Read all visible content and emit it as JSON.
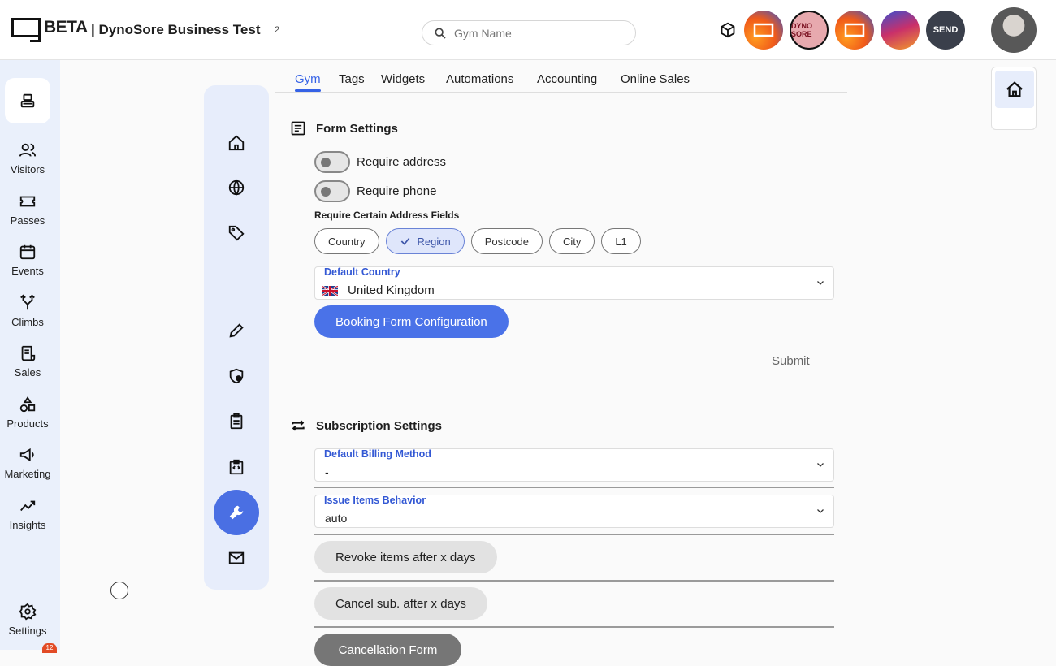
{
  "header": {
    "logo_text": "BETA",
    "business_name": "| DynoSore Business Test",
    "business_count": "2",
    "search_placeholder": "Gym Name",
    "gyms": [
      {
        "name": "gym-1",
        "color": "#f26b1d"
      },
      {
        "name": "gym-2",
        "text": "DYNO SORE",
        "color": "#d66e7b"
      },
      {
        "name": "gym-3",
        "color": "#f26b1d"
      },
      {
        "name": "gym-4",
        "color": "#c33a6e"
      },
      {
        "name": "gym-5",
        "text": "SEND",
        "color": "#3a3f4b"
      }
    ]
  },
  "sidebar": {
    "items": [
      {
        "label": "Visitors",
        "icon": "users-icon"
      },
      {
        "label": "Passes",
        "icon": "ticket-icon"
      },
      {
        "label": "Events",
        "icon": "calendar-icon"
      },
      {
        "label": "Climbs",
        "icon": "route-icon"
      },
      {
        "label": "Sales",
        "icon": "receipt-icon"
      },
      {
        "label": "Products",
        "icon": "shapes-icon"
      },
      {
        "label": "Marketing",
        "icon": "megaphone-icon"
      },
      {
        "label": "Insights",
        "icon": "chart-icon"
      }
    ],
    "settings_label": "Settings",
    "settings_badge": "12"
  },
  "tabs": [
    "Gym",
    "Tags",
    "Widgets",
    "Automations",
    "Accounting",
    "Online Sales"
  ],
  "form_settings": {
    "title": "Form Settings",
    "require_address": "Require address",
    "require_phone": "Require phone",
    "address_fields_label": "Require Certain Address Fields",
    "chips": [
      {
        "label": "Country",
        "selected": false
      },
      {
        "label": "Region",
        "selected": true
      },
      {
        "label": "Postcode",
        "selected": false
      },
      {
        "label": "City",
        "selected": false
      },
      {
        "label": "L1",
        "selected": false
      }
    ],
    "default_country_label": "Default Country",
    "default_country_value": "United Kingdom",
    "booking_button": "Booking Form Configuration",
    "submit": "Submit"
  },
  "subscription_settings": {
    "title": "Subscription Settings",
    "billing_label": "Default Billing Method",
    "billing_value": "-",
    "issue_label": "Issue Items Behavior",
    "issue_value": "auto",
    "revoke_button": "Revoke items after x days",
    "cancel_button": "Cancel sub. after x days",
    "cancellation_form_button": "Cancellation Form"
  },
  "colors": {
    "accent": "#4a72e8",
    "active_tab": "#3562e6",
    "badge": "#e24b26"
  }
}
